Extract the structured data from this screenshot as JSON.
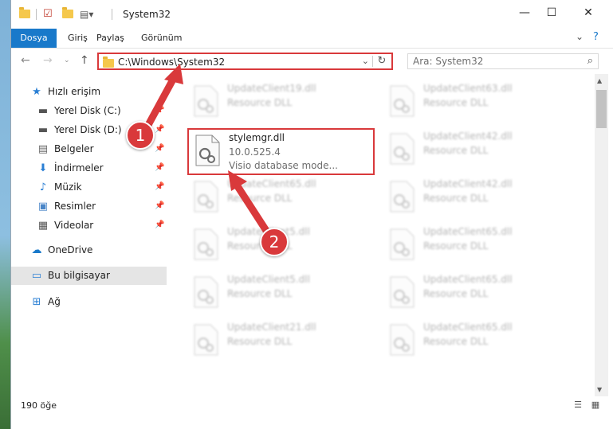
{
  "window": {
    "title": "System32"
  },
  "ribbon": {
    "tabs": [
      {
        "label": "Dosya",
        "active": true
      },
      {
        "label": "Giriş"
      },
      {
        "label": "Paylaş"
      },
      {
        "label": "Görünüm"
      }
    ]
  },
  "address": {
    "path": "C:\\Windows\\System32"
  },
  "search": {
    "placeholder": "Ara: System32"
  },
  "sidebar": {
    "items": [
      {
        "label": "Hızlı erişim",
        "icon": "star-icon"
      },
      {
        "label": "Yerel Disk (C:)",
        "icon": "drive-icon",
        "pinned": true
      },
      {
        "label": "Yerel Disk (D:)",
        "icon": "drive-icon",
        "pinned": true
      },
      {
        "label": "Belgeler",
        "icon": "documents-icon",
        "pinned": true
      },
      {
        "label": "İndirmeler",
        "icon": "download-icon",
        "pinned": true
      },
      {
        "label": "Müzik",
        "icon": "music-icon",
        "pinned": true
      },
      {
        "label": "Resimler",
        "icon": "pictures-icon",
        "pinned": true
      },
      {
        "label": "Videolar",
        "icon": "videos-icon",
        "pinned": true
      },
      {
        "label": "OneDrive",
        "icon": "cloud-icon"
      },
      {
        "label": "Bu bilgisayar",
        "icon": "computer-icon",
        "selected": true
      },
      {
        "label": "Ağ",
        "icon": "network-icon"
      }
    ]
  },
  "files": {
    "left_column": [
      {
        "name": "UpdateClient19.dll",
        "type": "Resource DLL"
      },
      {
        "name": "stylemgr.dll",
        "version": "10.0.525.4",
        "description": "Visio database mode...",
        "highlighted": true
      },
      {
        "name": "UpdateClient65.dll",
        "type": "Resource DLL"
      },
      {
        "name": "UpdateClient5.dll",
        "type": "Resource DLL"
      },
      {
        "name": "UpdateClient5.dll",
        "type": "Resource DLL"
      },
      {
        "name": "UpdateClient21.dll",
        "type": "Resource DLL"
      }
    ],
    "right_column": [
      {
        "name": "UpdateClient63.dll",
        "type": "Resource DLL"
      },
      {
        "name": "UpdateClient42.dll",
        "type": "Resource DLL"
      },
      {
        "name": "UpdateClient42.dll",
        "type": "Resource DLL"
      },
      {
        "name": "UpdateClient65.dll",
        "type": "Resource DLL"
      },
      {
        "name": "UpdateClient65.dll",
        "type": "Resource DLL"
      },
      {
        "name": "UpdateClient65.dll",
        "type": "Resource DLL"
      }
    ]
  },
  "status": {
    "count": "190 öğe"
  },
  "annotations": {
    "badge1": "1",
    "badge2": "2",
    "color": "#d9393b"
  },
  "colors": {
    "accent": "#1979ca",
    "highlight": "#d9393b"
  }
}
